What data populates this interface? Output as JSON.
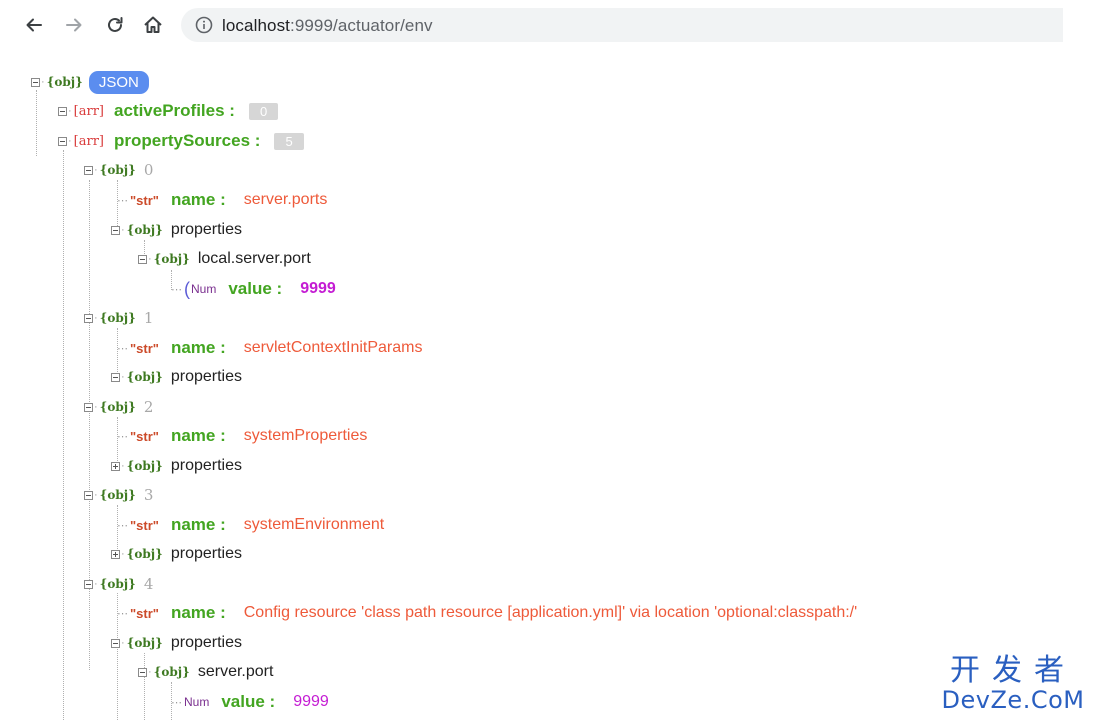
{
  "browser": {
    "url_host": "localhost",
    "url_rest": ":9999/actuator/env",
    "icons": [
      "back-arrow-icon",
      "forward-arrow-icon",
      "reload-icon",
      "home-icon",
      "info-icon"
    ]
  },
  "tree": {
    "root": {
      "type": "{obj}",
      "label": "JSON"
    },
    "activeProfiles": {
      "type": "[arr]",
      "key": "activeProfiles :",
      "count": "0"
    },
    "propertySources": {
      "type": "[arr]",
      "key": "propertySources :",
      "count": "5",
      "items": [
        {
          "index": "0",
          "name_key": "name :",
          "name_value": "server.ports",
          "props_label": "properties",
          "sub": {
            "label": "local.server.port",
            "value_key": "value :",
            "value": "9999"
          }
        },
        {
          "index": "1",
          "name_key": "name :",
          "name_value": "servletContextInitParams",
          "props_label": "properties"
        },
        {
          "index": "2",
          "name_key": "name :",
          "name_value": "systemProperties",
          "props_label": "properties"
        },
        {
          "index": "3",
          "name_key": "name :",
          "name_value": "systemEnvironment",
          "props_label": "properties"
        },
        {
          "index": "4",
          "name_key": "name :",
          "name_value": "Config resource 'class path resource [application.yml]' via location 'optional:classpath:/'",
          "props_label": "properties",
          "sub": {
            "label": "server.port",
            "value_key": "value :",
            "value": "9999"
          }
        }
      ]
    },
    "type_tags": {
      "obj": "{obj}",
      "arr": "[arr]",
      "str": "\"str\"",
      "num": "Num"
    }
  },
  "watermark": {
    "top": "开发者",
    "bottom": "DevZe.CoM"
  }
}
